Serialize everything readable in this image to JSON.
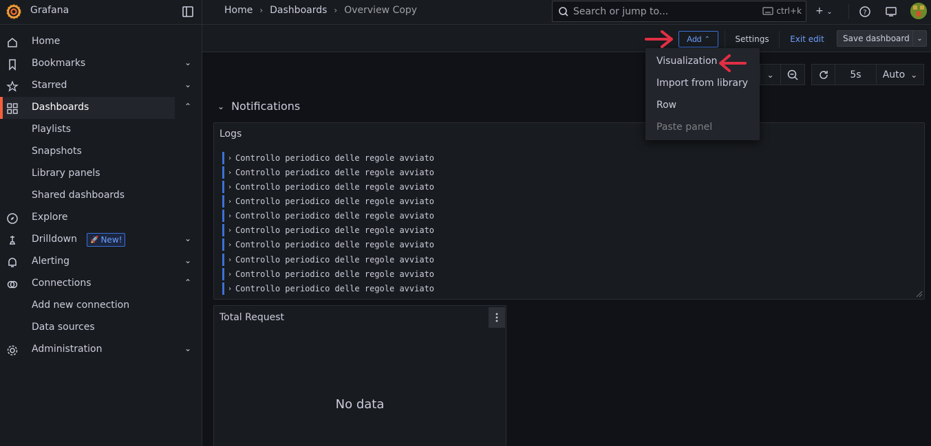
{
  "app": {
    "name": "Grafana"
  },
  "breadcrumb": {
    "home": "Home",
    "dashboards": "Dashboards",
    "current": "Overview Copy"
  },
  "search": {
    "placeholder": "Search or jump to...",
    "shortcut": "ctrl+k"
  },
  "sidebar": {
    "items": [
      {
        "label": "Home",
        "icon": "home-icon"
      },
      {
        "label": "Bookmarks",
        "icon": "bookmark-icon"
      },
      {
        "label": "Starred",
        "icon": "star-icon"
      },
      {
        "label": "Dashboards",
        "icon": "apps-icon"
      },
      {
        "label": "Playlists"
      },
      {
        "label": "Snapshots"
      },
      {
        "label": "Library panels"
      },
      {
        "label": "Shared dashboards"
      },
      {
        "label": "Explore",
        "icon": "compass-icon"
      },
      {
        "label": "Drilldown",
        "icon": "drilldown-icon",
        "badge": "New!"
      },
      {
        "label": "Alerting",
        "icon": "bell-icon"
      },
      {
        "label": "Connections",
        "icon": "link-icon"
      },
      {
        "label": "Add new connection"
      },
      {
        "label": "Data sources"
      },
      {
        "label": "Administration",
        "icon": "gear-icon"
      }
    ]
  },
  "toolbar": {
    "add": "Add",
    "settings": "Settings",
    "exit_edit": "Exit edit",
    "save": "Save dashboard"
  },
  "time_controls": {
    "refresh_interval": "5s",
    "auto": "Auto"
  },
  "add_menu": {
    "items": [
      "Visualization",
      "Import from library",
      "Row",
      "Paste panel"
    ]
  },
  "row": {
    "title": "Notifications"
  },
  "logs_panel": {
    "title": "Logs",
    "lines": [
      "Controllo periodico delle regole avviato",
      "Controllo periodico delle regole avviato",
      "Controllo periodico delle regole avviato",
      "Controllo periodico delle regole avviato",
      "Controllo periodico delle regole avviato",
      "Controllo periodico delle regole avviato",
      "Controllo periodico delle regole avviato",
      "Controllo periodico delle regole avviato",
      "Controllo periodico delle regole avviato",
      "Controllo periodico delle regole avviato"
    ]
  },
  "total_request_panel": {
    "title": "Total Request",
    "empty_text": "No data"
  },
  "colors": {
    "accent": "#3d71d9",
    "active_marker": "#f55f3e",
    "annotation": "#e02f44"
  }
}
